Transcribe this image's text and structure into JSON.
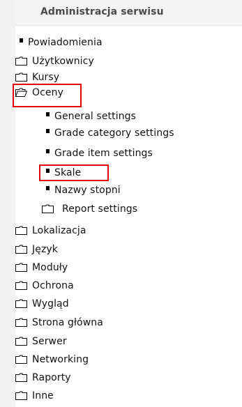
{
  "block": {
    "title": "Administracja serwisu",
    "collapse_symbol": "−"
  },
  "tree": {
    "items": [
      {
        "label": "Powiadomienia",
        "icon": "bullet-icon"
      },
      {
        "label": "Użytkownicy",
        "icon": "folder-closed-icon"
      },
      {
        "label": "Kursy",
        "icon": "folder-closed-icon"
      },
      {
        "label": "Oceny",
        "icon": "folder-open-icon",
        "highlighted": true
      },
      {
        "label": "General settings",
        "icon": "bullet-icon"
      },
      {
        "label": "Grade category settings",
        "icon": "bullet-icon"
      },
      {
        "label": "Grade item settings",
        "icon": "bullet-icon"
      },
      {
        "label": "Skale",
        "icon": "bullet-icon",
        "highlighted": true
      },
      {
        "label": "Nazwy stopni",
        "icon": "bullet-icon"
      },
      {
        "label": "Report settings",
        "icon": "folder-closed-icon"
      },
      {
        "label": "Lokalizacja",
        "icon": "folder-closed-icon"
      },
      {
        "label": "Język",
        "icon": "folder-closed-icon"
      },
      {
        "label": "Moduły",
        "icon": "folder-closed-icon"
      },
      {
        "label": "Ochrona",
        "icon": "folder-closed-icon"
      },
      {
        "label": "Wygląd",
        "icon": "folder-closed-icon"
      },
      {
        "label": "Strona główna",
        "icon": "folder-closed-icon"
      },
      {
        "label": "Serwer",
        "icon": "folder-closed-icon"
      },
      {
        "label": "Networking",
        "icon": "folder-closed-icon"
      },
      {
        "label": "Raporty",
        "icon": "folder-closed-icon"
      },
      {
        "label": "Inne",
        "icon": "folder-closed-icon"
      }
    ]
  },
  "colors": {
    "highlight": "#e60000",
    "header_bg": "#f4f4f4"
  }
}
